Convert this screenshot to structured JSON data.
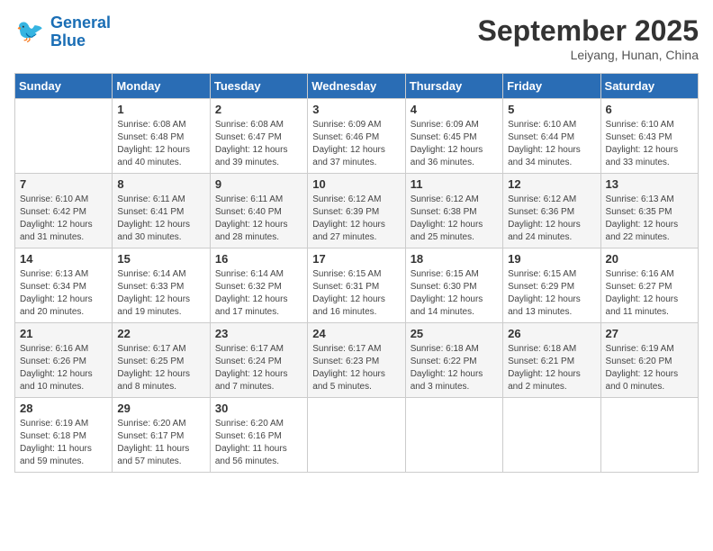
{
  "header": {
    "logo_line1": "General",
    "logo_line2": "Blue",
    "month": "September 2025",
    "location": "Leiyang, Hunan, China"
  },
  "days_of_week": [
    "Sunday",
    "Monday",
    "Tuesday",
    "Wednesday",
    "Thursday",
    "Friday",
    "Saturday"
  ],
  "weeks": [
    [
      {
        "day": "",
        "info": ""
      },
      {
        "day": "1",
        "info": "Sunrise: 6:08 AM\nSunset: 6:48 PM\nDaylight: 12 hours\nand 40 minutes."
      },
      {
        "day": "2",
        "info": "Sunrise: 6:08 AM\nSunset: 6:47 PM\nDaylight: 12 hours\nand 39 minutes."
      },
      {
        "day": "3",
        "info": "Sunrise: 6:09 AM\nSunset: 6:46 PM\nDaylight: 12 hours\nand 37 minutes."
      },
      {
        "day": "4",
        "info": "Sunrise: 6:09 AM\nSunset: 6:45 PM\nDaylight: 12 hours\nand 36 minutes."
      },
      {
        "day": "5",
        "info": "Sunrise: 6:10 AM\nSunset: 6:44 PM\nDaylight: 12 hours\nand 34 minutes."
      },
      {
        "day": "6",
        "info": "Sunrise: 6:10 AM\nSunset: 6:43 PM\nDaylight: 12 hours\nand 33 minutes."
      }
    ],
    [
      {
        "day": "7",
        "info": "Sunrise: 6:10 AM\nSunset: 6:42 PM\nDaylight: 12 hours\nand 31 minutes."
      },
      {
        "day": "8",
        "info": "Sunrise: 6:11 AM\nSunset: 6:41 PM\nDaylight: 12 hours\nand 30 minutes."
      },
      {
        "day": "9",
        "info": "Sunrise: 6:11 AM\nSunset: 6:40 PM\nDaylight: 12 hours\nand 28 minutes."
      },
      {
        "day": "10",
        "info": "Sunrise: 6:12 AM\nSunset: 6:39 PM\nDaylight: 12 hours\nand 27 minutes."
      },
      {
        "day": "11",
        "info": "Sunrise: 6:12 AM\nSunset: 6:38 PM\nDaylight: 12 hours\nand 25 minutes."
      },
      {
        "day": "12",
        "info": "Sunrise: 6:12 AM\nSunset: 6:36 PM\nDaylight: 12 hours\nand 24 minutes."
      },
      {
        "day": "13",
        "info": "Sunrise: 6:13 AM\nSunset: 6:35 PM\nDaylight: 12 hours\nand 22 minutes."
      }
    ],
    [
      {
        "day": "14",
        "info": "Sunrise: 6:13 AM\nSunset: 6:34 PM\nDaylight: 12 hours\nand 20 minutes."
      },
      {
        "day": "15",
        "info": "Sunrise: 6:14 AM\nSunset: 6:33 PM\nDaylight: 12 hours\nand 19 minutes."
      },
      {
        "day": "16",
        "info": "Sunrise: 6:14 AM\nSunset: 6:32 PM\nDaylight: 12 hours\nand 17 minutes."
      },
      {
        "day": "17",
        "info": "Sunrise: 6:15 AM\nSunset: 6:31 PM\nDaylight: 12 hours\nand 16 minutes."
      },
      {
        "day": "18",
        "info": "Sunrise: 6:15 AM\nSunset: 6:30 PM\nDaylight: 12 hours\nand 14 minutes."
      },
      {
        "day": "19",
        "info": "Sunrise: 6:15 AM\nSunset: 6:29 PM\nDaylight: 12 hours\nand 13 minutes."
      },
      {
        "day": "20",
        "info": "Sunrise: 6:16 AM\nSunset: 6:27 PM\nDaylight: 12 hours\nand 11 minutes."
      }
    ],
    [
      {
        "day": "21",
        "info": "Sunrise: 6:16 AM\nSunset: 6:26 PM\nDaylight: 12 hours\nand 10 minutes."
      },
      {
        "day": "22",
        "info": "Sunrise: 6:17 AM\nSunset: 6:25 PM\nDaylight: 12 hours\nand 8 minutes."
      },
      {
        "day": "23",
        "info": "Sunrise: 6:17 AM\nSunset: 6:24 PM\nDaylight: 12 hours\nand 7 minutes."
      },
      {
        "day": "24",
        "info": "Sunrise: 6:17 AM\nSunset: 6:23 PM\nDaylight: 12 hours\nand 5 minutes."
      },
      {
        "day": "25",
        "info": "Sunrise: 6:18 AM\nSunset: 6:22 PM\nDaylight: 12 hours\nand 3 minutes."
      },
      {
        "day": "26",
        "info": "Sunrise: 6:18 AM\nSunset: 6:21 PM\nDaylight: 12 hours\nand 2 minutes."
      },
      {
        "day": "27",
        "info": "Sunrise: 6:19 AM\nSunset: 6:20 PM\nDaylight: 12 hours\nand 0 minutes."
      }
    ],
    [
      {
        "day": "28",
        "info": "Sunrise: 6:19 AM\nSunset: 6:18 PM\nDaylight: 11 hours\nand 59 minutes."
      },
      {
        "day": "29",
        "info": "Sunrise: 6:20 AM\nSunset: 6:17 PM\nDaylight: 11 hours\nand 57 minutes."
      },
      {
        "day": "30",
        "info": "Sunrise: 6:20 AM\nSunset: 6:16 PM\nDaylight: 11 hours\nand 56 minutes."
      },
      {
        "day": "",
        "info": ""
      },
      {
        "day": "",
        "info": ""
      },
      {
        "day": "",
        "info": ""
      },
      {
        "day": "",
        "info": ""
      }
    ]
  ]
}
